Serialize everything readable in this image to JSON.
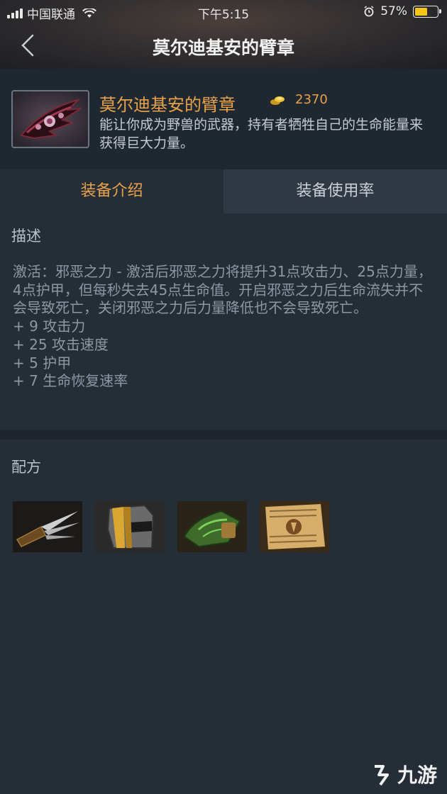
{
  "status_bar": {
    "carrier": "中国联通",
    "time": "下午5:15",
    "battery": "57%",
    "battery_level": 0.57
  },
  "nav": {
    "title": "莫尔迪基安的臂章",
    "back_icon": "chevron-left-icon"
  },
  "item": {
    "name": "莫尔迪基安的臂章",
    "cost": "2370",
    "description": "能让你成为野兽的武器，持有者牺牲自己的生命能量来获得巨大力量。",
    "icon": "armlet-icon"
  },
  "tabs": [
    {
      "label": "装备介绍",
      "active": true
    },
    {
      "label": "装备使用率",
      "active": false
    }
  ],
  "description_section": {
    "title": "描述",
    "lines": [
      "激活：邪恶之力 - 激活后邪恶之力将提升31点攻击力、25点力量，4点护甲，但每秒失去45点生命值。开启邪恶之力后生命流失并不会导致死亡，关闭邪恶之力后力量降低也不会导致死亡。",
      "+ 9 攻击力",
      "+ 25 攻击速度",
      "+ 5 护甲",
      "+ 7 生命恢复速率"
    ]
  },
  "recipe_section": {
    "title": "配方",
    "items": [
      {
        "icon": "blades-of-attack-icon"
      },
      {
        "icon": "helm-of-iron-will-icon"
      },
      {
        "icon": "gloves-of-haste-icon"
      },
      {
        "icon": "recipe-scroll-icon"
      }
    ]
  },
  "watermark": "九游",
  "colors": {
    "accent": "#e8a24a",
    "background": "#252d37",
    "header_bg": "#1f2730"
  }
}
